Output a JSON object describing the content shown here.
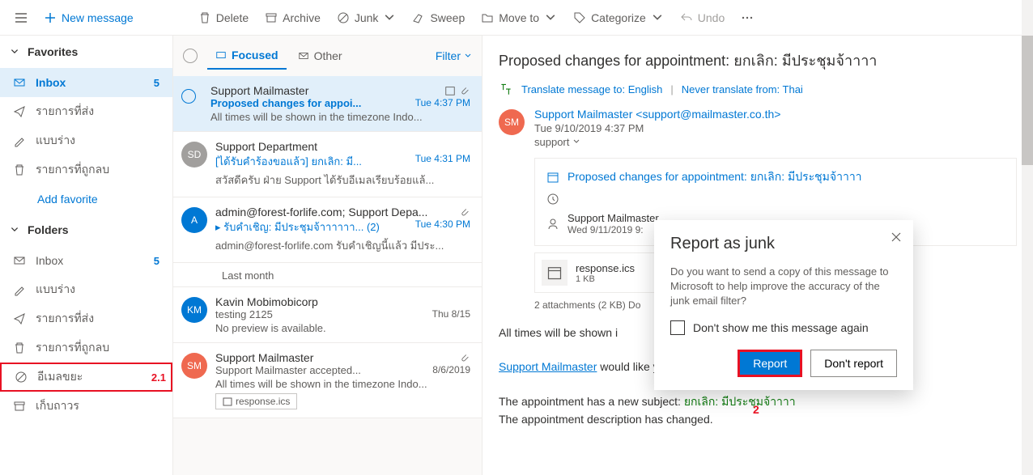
{
  "toolbar": {
    "new_message": "New message",
    "delete": "Delete",
    "archive": "Archive",
    "junk": "Junk",
    "sweep": "Sweep",
    "move_to": "Move to",
    "categorize": "Categorize",
    "undo": "Undo"
  },
  "nav": {
    "favorites": "Favorites",
    "inbox": "Inbox",
    "inbox_count": "5",
    "sent": "รายการที่ส่ง",
    "drafts": "แบบร่าง",
    "deleted": "รายการที่ถูกลบ",
    "add_favorite": "Add favorite",
    "folders": "Folders",
    "f_inbox": "Inbox",
    "f_inbox_count": "5",
    "f_drafts": "แบบร่าง",
    "f_sent": "รายการที่ส่ง",
    "f_deleted": "รายการที่ถูกลบ",
    "junk": "อีเมลขยะ",
    "junk_annot": "2.1",
    "archive": "เก็บถาวร"
  },
  "tabs": {
    "focused": "Focused",
    "other": "Other",
    "filter": "Filter"
  },
  "divider_last_month": "Last month",
  "messages": [
    {
      "sender": "Support Mailmaster",
      "subject": "Proposed changes for appoi...",
      "date": "Tue 4:37 PM",
      "preview": "All times will be shown in the timezone Indo..."
    },
    {
      "avatar": "SD",
      "avatar_color": "#a19f9d",
      "sender": "Support Department",
      "subject": "[ได้รับคำร้องขอแล้ว] ยกเลิก: มี...",
      "date": "Tue 4:31 PM",
      "preview": "สวัสดีครับ ฝ่าย Support ได้รับอีเมลเรียบร้อยแล้..."
    },
    {
      "avatar": "A",
      "avatar_color": "#0078d4",
      "sender": "admin@forest-forlife.com; Support Depa...",
      "subject": "รับคำเชิญ: มีประชุมจ้าาาาาา...   (2)",
      "sub_prefix": "▸ ",
      "date": "Tue 4:30 PM",
      "preview": "admin@forest-forlife.com รับคำเชิญนี้แล้ว มีประ..."
    },
    {
      "avatar": "KM",
      "avatar_color": "#0078d4",
      "sender": "Kavin Mobimobicorp",
      "subject": "testing 2125",
      "date": "Thu 8/15",
      "preview": "No preview is available."
    },
    {
      "avatar": "SM",
      "avatar_color": "#ef6950",
      "sender": "Support Mailmaster",
      "subject": "Support Mailmaster accepted...",
      "date": "8/6/2019",
      "preview": "All times will be shown in the timezone Indo...",
      "att": "response.ics"
    }
  ],
  "reading": {
    "subject": "Proposed changes for appointment: ยกเลิก: มีประชุมจ้าาาา",
    "translate": "Translate message to: English",
    "never": "Never translate from: Thai",
    "from": "Support Mailmaster <support@mailmaster.co.th>",
    "date": "Tue 9/10/2019 4:37 PM",
    "to": "support",
    "avatar": "SM",
    "card_title": "Proposed changes for appointment: ยกเลิก: มีประชุมจ้าาาา",
    "card_from": "Support Mailmaster",
    "card_date": "Wed 9/11/2019 9:",
    "att_name": "response.ics",
    "att_size": "1 KB",
    "att_summary": "2 attachments (2 KB)   Do",
    "body1_a": "All times will be shown i",
    "body2_a": "Support Mailmaster",
    "body2_b": " would like you to change the appointment:",
    "body3_a": "The appointment has a new subject: ",
    "body3_b": "ยกเลิก: มีประชุมจ้าาาา",
    "body4": "The appointment description has changed."
  },
  "modal": {
    "title": "Report as junk",
    "text": "Do you want to send a copy of this message to Microsoft to help improve the accuracy of the junk email filter?",
    "checkbox": "Don't show me this message again",
    "report": "Report",
    "dont_report": "Don't report",
    "annot": "2"
  }
}
